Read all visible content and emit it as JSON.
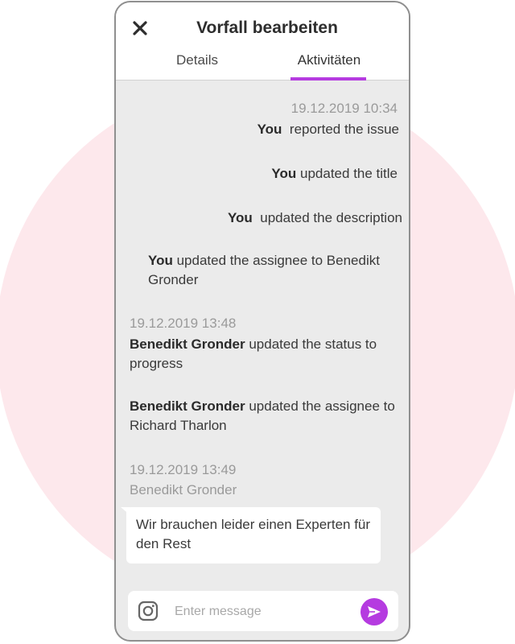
{
  "header": {
    "title": "Vorfall bearbeiten",
    "close_icon": "close-icon",
    "tabs": [
      {
        "label": "Details",
        "active": false
      },
      {
        "label": "Aktivitäten",
        "active": true
      }
    ]
  },
  "activity": {
    "groups": [
      {
        "timestamp": "19.12.2019 10:34",
        "entries": [
          {
            "actor": "You",
            "text": "reported the issue"
          },
          {
            "actor": "You",
            "text": "updated the title"
          },
          {
            "actor": "You",
            "text": "updated the description"
          },
          {
            "actor": "You",
            "text": "updated the assignee to Benedikt Gronder"
          }
        ]
      },
      {
        "timestamp": "19.12.2019 13:48",
        "entries": [
          {
            "actor": "Benedikt Gronder",
            "text": "updated the status to progress"
          },
          {
            "actor": "Benedikt Gronder",
            "text": "updated the assignee to Richard Tharlon"
          }
        ]
      },
      {
        "timestamp": "19.12.2019 13:49",
        "author": "Benedikt Gronder",
        "message": "Wir brauchen leider einen Experten für den Rest"
      }
    ]
  },
  "composer": {
    "placeholder": "Enter message",
    "left_icon": "instagram-icon",
    "send_icon": "send-icon"
  },
  "colors": {
    "accent": "#b53be0",
    "background_circle": "#fde8ec",
    "feed_background": "#ebebeb"
  }
}
